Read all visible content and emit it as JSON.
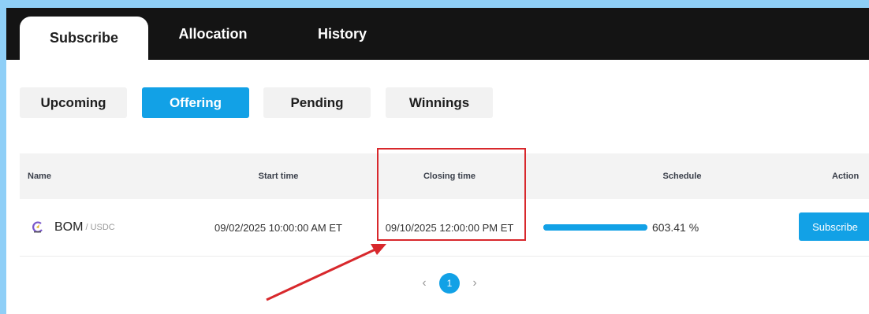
{
  "main_tabs": [
    {
      "label": "Subscribe",
      "active": true
    },
    {
      "label": "Allocation",
      "active": false
    },
    {
      "label": "History",
      "active": false
    }
  ],
  "sub_tabs": [
    {
      "label": "Upcoming",
      "active": false
    },
    {
      "label": "Offering",
      "active": true
    },
    {
      "label": "Pending",
      "active": false
    },
    {
      "label": "Winnings",
      "active": false
    }
  ],
  "table": {
    "headers": [
      "Name",
      "Start time",
      "Closing time",
      "Schedule",
      "Action"
    ],
    "rows": [
      {
        "icon": "bom-coin-icon",
        "base": "BOM",
        "quote": "/ USDC",
        "start_time": "09/02/2025 10:00:00 AM ET",
        "closing_time": "09/10/2025 12:00:00 PM ET",
        "progress_fraction": 1.0,
        "schedule": "603.41 %",
        "action_label": "Subscribe"
      }
    ]
  },
  "pagination": {
    "current_page": "1",
    "prev_icon": "chevron-left-icon",
    "next_icon": "chevron-right-icon"
  },
  "colors": {
    "accent": "#12a1e6",
    "annotation": "#d8282c",
    "topbar": "#141414",
    "background": "#8fcff7"
  }
}
